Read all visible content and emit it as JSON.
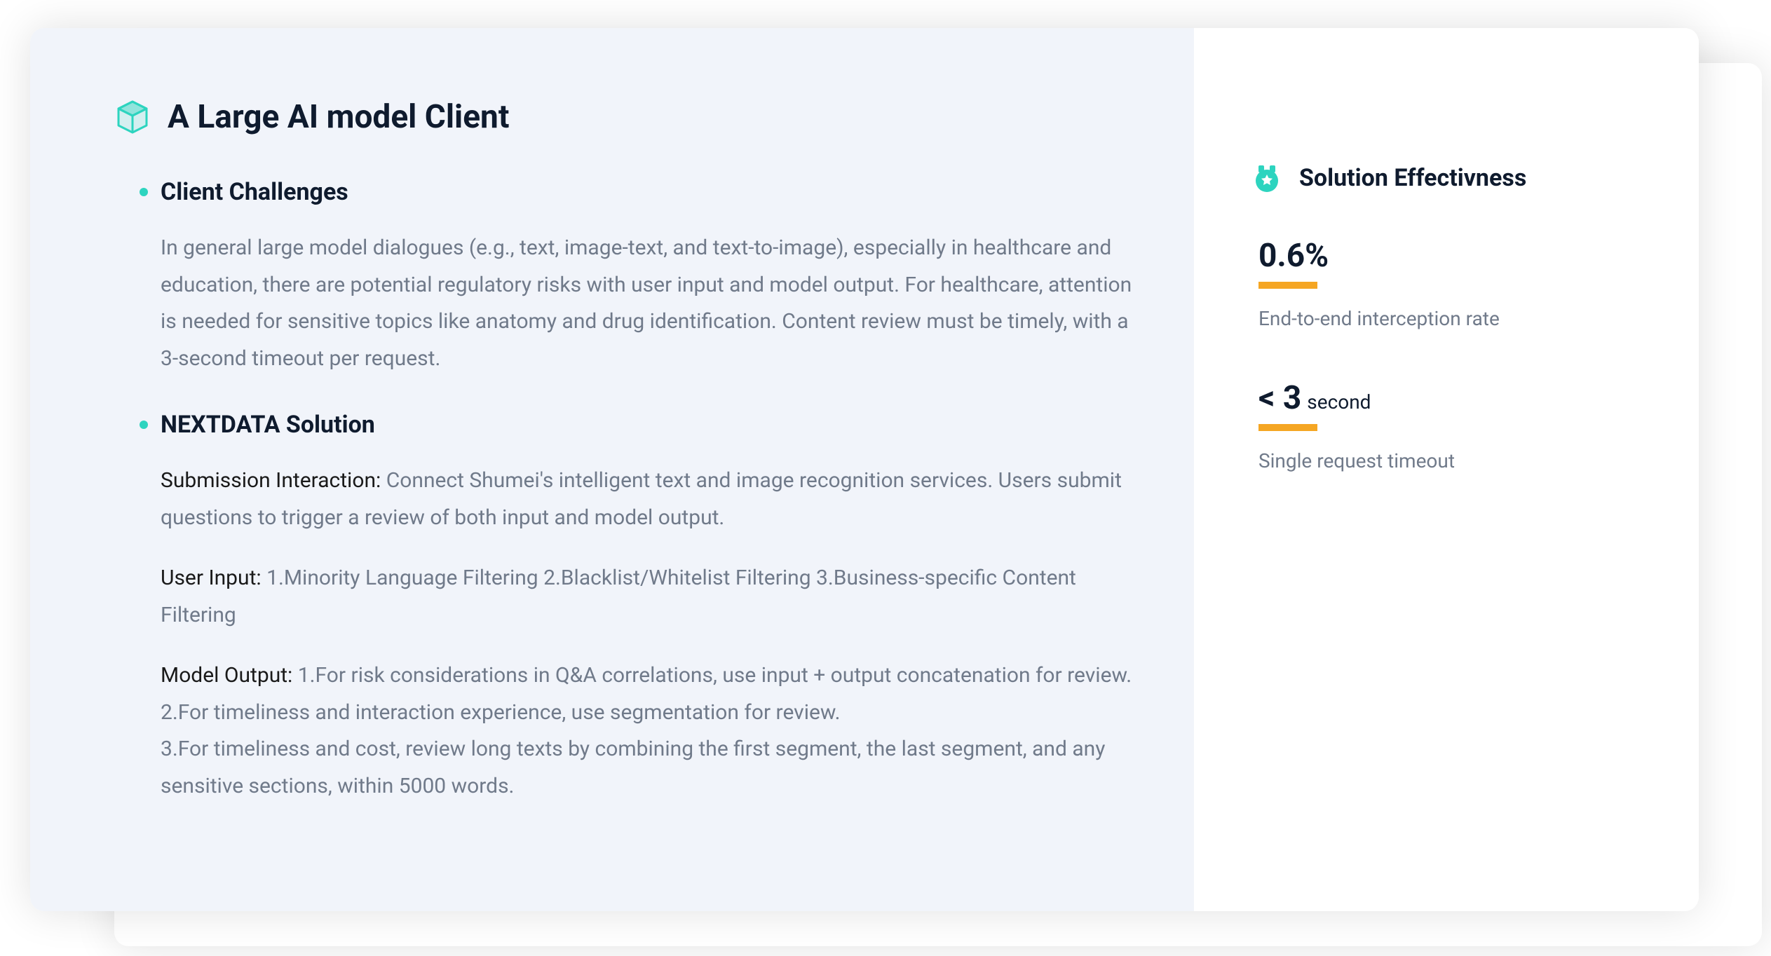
{
  "title": "A Large AI model Client",
  "sections": {
    "challenges": {
      "heading": "Client Challenges",
      "body": "In general large model dialogues (e.g., text, image-text, and text-to-image), especially in healthcare and education, there are potential regulatory risks with user input and model output. For healthcare, attention is needed for sensitive topics like anatomy and drug identification. Content review must be timely, with a 3-second timeout per request."
    },
    "solution": {
      "heading": "NEXTDATA Solution",
      "items": [
        {
          "label": "Submission Interaction: ",
          "text": "Connect Shumei's intelligent text and image recognition services. Users submit questions to trigger a review of both input and model output."
        },
        {
          "label": "User Input: ",
          "text": "1.Minority Language Filtering 2.Blacklist/Whitelist Filtering 3.Business-specific Content Filtering"
        },
        {
          "label": "Model Output: ",
          "text": "1.For risk considerations in Q&A correlations, use input + output concatenation for review.\n2.For timeliness and interaction experience, use segmentation for review.\n3.For timeliness and cost, review long texts by combining the first segment, the last segment, and any sensitive sections, within 5000 words."
        }
      ]
    }
  },
  "effectiveness": {
    "heading": "Solution Effectivness",
    "metrics": [
      {
        "value": "0.6%",
        "unit": "",
        "label": "End-to-end interception rate"
      },
      {
        "value": "< 3",
        "unit": "second",
        "label": "Single request timeout"
      }
    ]
  }
}
